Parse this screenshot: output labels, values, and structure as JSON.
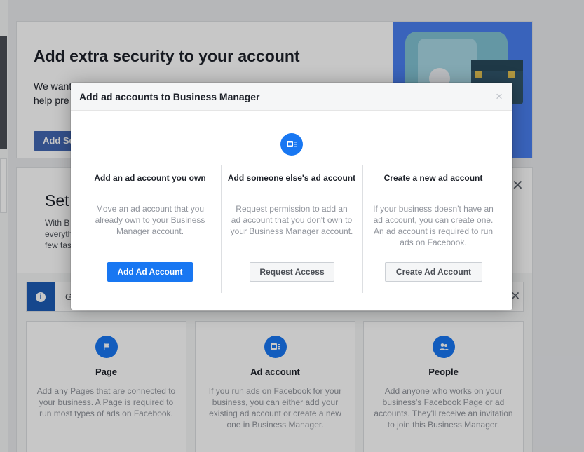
{
  "background": {
    "security": {
      "title": "Add extra security to your account",
      "description": "We want to keep your account secure. Here's what you can do right now to help pre",
      "button_label": "Add Se"
    },
    "setup": {
      "title": "Set",
      "description_lines": [
        "With B",
        "everyth",
        "few tas"
      ],
      "tip_text": "G"
    },
    "options": [
      {
        "title": "Page",
        "description": "Add any Pages that are connected to your business. A Page is required to run most types of ads on Facebook.",
        "icon": "flag-icon"
      },
      {
        "title": "Ad account",
        "description": "If you run ads on Facebook for your business, you can either add your existing ad account or create a new one in Business Manager.",
        "icon": "ad-account-icon"
      },
      {
        "title": "People",
        "description": "Add anyone who works on your business's Facebook Page or ad accounts. They'll receive an invitation to join this Business Manager.",
        "icon": "people-icon"
      }
    ]
  },
  "dialog": {
    "title": "Add ad accounts to Business Manager",
    "close_glyph": "×",
    "top_icon": "ad-account-icon",
    "columns": [
      {
        "title": "Add an ad account you own",
        "description": "Move an ad account that you already own to your Business Manager account.",
        "button_label": "Add Ad Account",
        "button_style": "primary"
      },
      {
        "title": "Add someone else's ad account",
        "description": "Request permission to add an ad account that you don't own to your Business Manager account.",
        "button_label": "Request Access",
        "button_style": "secondary"
      },
      {
        "title": "Create a new ad account",
        "description": "If your business doesn't have an ad account, you can create one. An ad account is required to run ads on Facebook.",
        "button_label": "Create Ad Account",
        "button_style": "secondary"
      }
    ]
  },
  "colors": {
    "accent": "#1877f2",
    "tip_icon_bg": "#1d5bb5",
    "security_button": "#4267b2",
    "illustration_bg": "#4a7ff0"
  }
}
